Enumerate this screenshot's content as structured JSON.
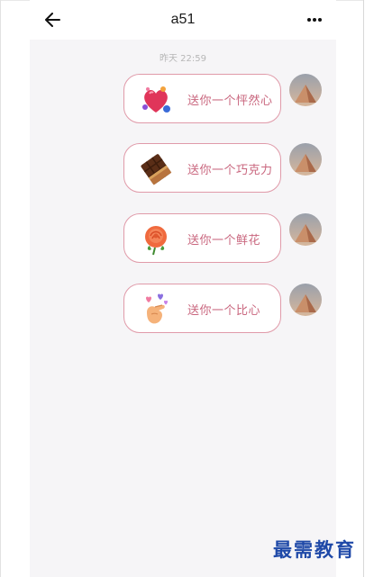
{
  "header": {
    "title": "a51",
    "back_icon": "arrow-left-icon",
    "more_icon": "more-horizontal-icon"
  },
  "chat": {
    "timestamp": "昨天 22:59",
    "messages": [
      {
        "icon": "hearts-icon",
        "text": "送你一个怦然心"
      },
      {
        "icon": "chocolate-icon",
        "text": "送你一个巧克力"
      },
      {
        "icon": "rose-icon",
        "text": "送你一个鲜花"
      },
      {
        "icon": "finger-heart-icon",
        "text": "送你一个比心"
      }
    ]
  },
  "watermark": "最需教育",
  "colors": {
    "accent_text": "#c9667e",
    "bubble_border": "#e09aa9",
    "chat_background": "#f6f5f7",
    "watermark": "#1f49a8"
  }
}
